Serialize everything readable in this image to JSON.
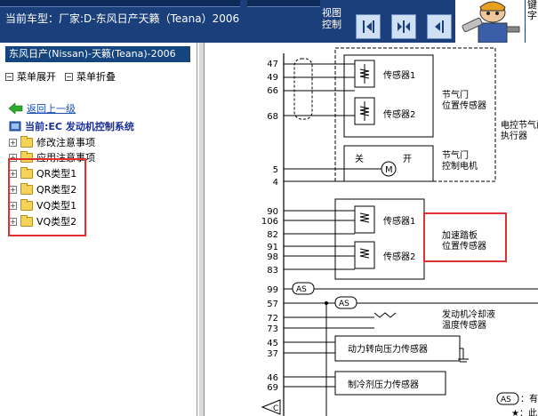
{
  "header": {
    "car_info": "当前车型：厂家:D-东风日产天籁（Teana）2006",
    "view_label": "视图控制",
    "key_text": "键字",
    "view_buttons": [
      "view-left",
      "view-center",
      "view-right"
    ]
  },
  "left": {
    "model_title": "东风日产(Nissan)-天籁(Teana)-2006",
    "menu": {
      "expand": "菜单展开",
      "collapse": "菜单折叠"
    },
    "back": "返回上一级",
    "current": "当前:EC 发动机控制系统",
    "tree": [
      {
        "label": "修改注意事项"
      },
      {
        "label": "应用注意事项"
      },
      {
        "label": "QR类型1"
      },
      {
        "label": "QR类型2"
      },
      {
        "label": "VQ类型1"
      },
      {
        "label": "VQ类型2"
      }
    ]
  },
  "diagram": {
    "pins": [
      "47",
      "49",
      "66",
      "68",
      "5",
      "4",
      "90",
      "106",
      "82",
      "91",
      "98",
      "83",
      "99",
      "57",
      "72",
      "73",
      "45",
      "37",
      "46",
      "69"
    ],
    "labels": {
      "sensor1a": "传感器1",
      "sensor2a": "传感器2",
      "throttle_pos_1": "节气门",
      "throttle_pos_2": "位置传感器",
      "actuator_1": "电控节气门",
      "actuator_2": "执行器",
      "off": "关",
      "on": "开",
      "throttle_motor_1": "节气门",
      "throttle_motor_2": "控制电机",
      "sensor1b": "传感器1",
      "sensor2b": "传感器2",
      "accel_1": "加速踏板",
      "accel_2": "位置传感器",
      "as1": "AS",
      "as2": "AS",
      "coolant_1": "发动机冷却液",
      "coolant_2": "温度传感器",
      "ps_sensor": "动力转向压力传感器",
      "ref_sensor": "制冷剂压力传感器",
      "legend_as": "AS",
      "legend_as_text": "：有",
      "legend_star": "★：此",
      "motor": "M",
      "c_mark": "C"
    }
  }
}
